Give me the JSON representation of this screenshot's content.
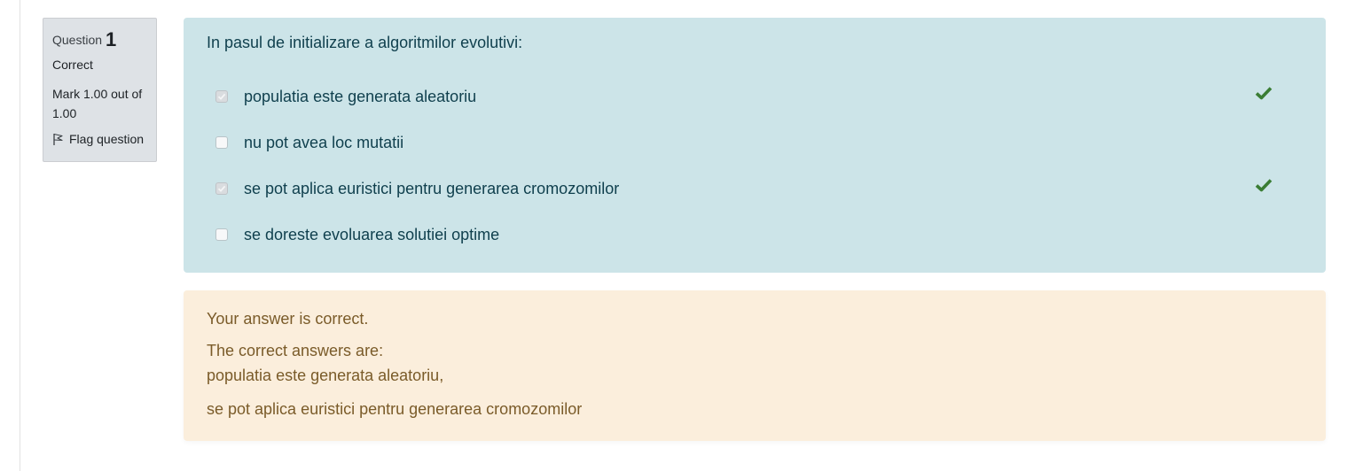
{
  "info": {
    "question_word": "Question",
    "question_number": "1",
    "state": "Correct",
    "grade": "Mark 1.00 out of 1.00",
    "flag_label": "Flag question"
  },
  "formulation": {
    "question_text": "In pasul de initializare a algoritmilor evolutivi:",
    "answers": [
      {
        "label": "populatia este generata aleatoriu",
        "checked": true,
        "correct_mark": "check-icon"
      },
      {
        "label": "nu pot avea loc mutatii",
        "checked": false
      },
      {
        "label": "se pot aplica euristici pentru generarea cromozomilor",
        "checked": true,
        "correct_mark": "check-icon"
      },
      {
        "label": "se doreste evoluarea solutiei optime",
        "checked": false
      }
    ]
  },
  "outcome": {
    "feedback": "Your answer is correct.",
    "right_answer_heading": "The correct answers are:",
    "right_answers": [
      "populatia este generata aleatoriu,",
      "se pot aplica euristici pentru generarea cromozomilor"
    ]
  },
  "colors": {
    "formulation_bg": "#cce4e8",
    "outcome_bg": "#fbeedc",
    "info_bg": "#dee2e6",
    "correct_green": "#3a7d34"
  }
}
